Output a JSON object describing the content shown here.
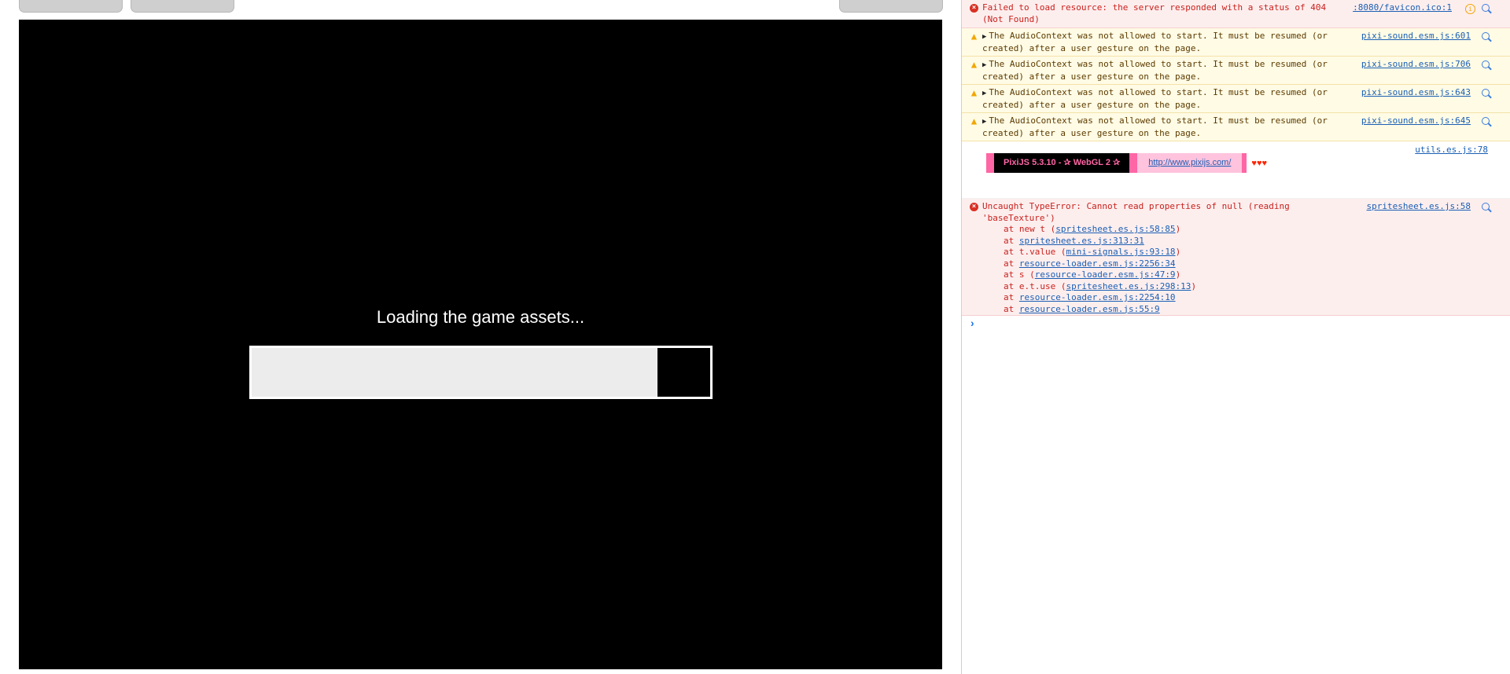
{
  "game": {
    "loading_text": "Loading the game assets...",
    "progress_fraction": 0.885
  },
  "console": {
    "messages": [
      {
        "level": "error",
        "text": "Failed to load resource: the server responded with a status of 404 (Not Found)",
        "source": ":8080/favicon.ico:1"
      },
      {
        "level": "warning",
        "text": "The AudioContext was not allowed to start. It must be resumed (or created) after a user gesture on the page.",
        "source": "pixi-sound.esm.js:601"
      },
      {
        "level": "warning",
        "text": "The AudioContext was not allowed to start. It must be resumed (or created) after a user gesture on the page.",
        "source": "pixi-sound.esm.js:706"
      },
      {
        "level": "warning",
        "text": "The AudioContext was not allowed to start. It must be resumed (or created) after a user gesture on the page.",
        "source": "pixi-sound.esm.js:643"
      },
      {
        "level": "warning",
        "text": "The AudioContext was not allowed to start. It must be resumed (or created) after a user gesture on the page.",
        "source": "pixi-sound.esm.js:645"
      },
      {
        "level": "log",
        "source": "utils.es.js:78",
        "banner": {
          "label": "PixiJS 5.3.10 - ✰ WebGL 2 ✰",
          "url": "http://www.pixijs.com/",
          "hearts": "♥♥♥"
        }
      },
      {
        "level": "error",
        "text": "Uncaught TypeError: Cannot read properties of null (reading 'baseTexture')",
        "source": "spritesheet.es.js:58",
        "stack": [
          {
            "prefix": "at new t (",
            "link": "spritesheet.es.js:58:85",
            "suffix": ")"
          },
          {
            "prefix": "at ",
            "link": "spritesheet.es.js:313:31",
            "suffix": ""
          },
          {
            "prefix": "at t.value (",
            "link": "mini-signals.js:93:18",
            "suffix": ")"
          },
          {
            "prefix": "at ",
            "link": "resource-loader.esm.js:2256:34",
            "suffix": ""
          },
          {
            "prefix": "at s (",
            "link": "resource-loader.esm.js:47:9",
            "suffix": ")"
          },
          {
            "prefix": "at e.t.use (",
            "link": "spritesheet.es.js:298:13",
            "suffix": ")"
          },
          {
            "prefix": "at ",
            "link": "resource-loader.esm.js:2254:10",
            "suffix": ""
          },
          {
            "prefix": "at ",
            "link": "resource-loader.esm.js:55:9",
            "suffix": ""
          }
        ]
      }
    ],
    "prompt_symbol": "›"
  },
  "colors": {
    "error_bg": "#fdeeee",
    "error_text": "#c8221d",
    "warning_bg": "#fffbe5",
    "link": "#1a5fb4",
    "pixi_pink": "#ff66a5"
  }
}
